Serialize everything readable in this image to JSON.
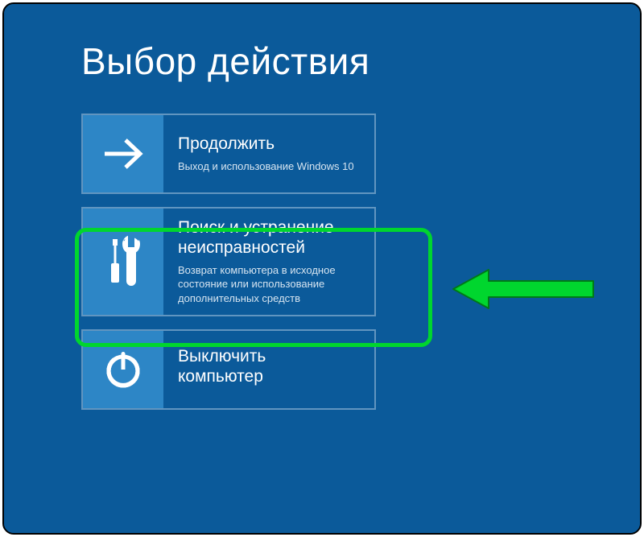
{
  "title": "Выбор действия",
  "options": {
    "continue": {
      "title": "Продолжить",
      "desc": "Выход и использование Windows 10"
    },
    "troubleshoot": {
      "title": "Поиск и устранение неисправностей",
      "desc": "Возврат компьютера в исходное состояние или использование дополнительных средств"
    },
    "poweroff": {
      "title": "Выключить компьютер",
      "desc": ""
    }
  },
  "colors": {
    "background": "#0b5a9a",
    "tile": "#2d86c6",
    "border": "#6195c0",
    "highlight": "#00d62e"
  }
}
